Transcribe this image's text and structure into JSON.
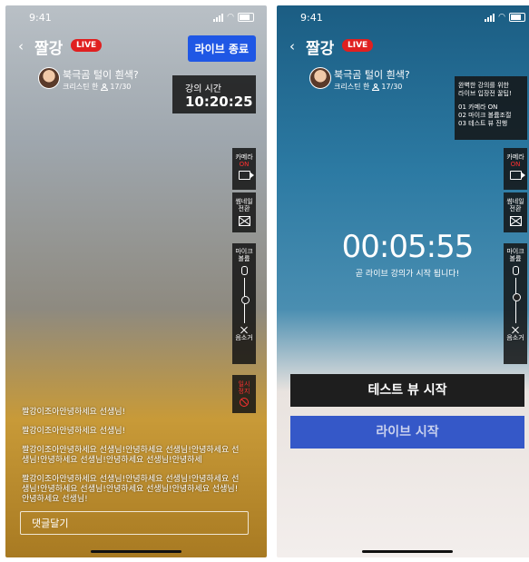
{
  "status_time": "9:41",
  "brand": "짤강",
  "live_badge": "LIVE",
  "lecture": {
    "title": "북극곰 털이 흰색?",
    "instructor": "크리스틴 한",
    "viewers": "17/30"
  },
  "screen1": {
    "end_button": "라이브 종료",
    "timer_label": "강의 시간",
    "timer_value": "10:20:25",
    "camera": {
      "label": "카메라",
      "state": "ON"
    },
    "thumbnail": {
      "line1": "썸네일",
      "line2": "전환"
    },
    "mic": {
      "line1": "마이크",
      "line2": "볼륨",
      "bottom": "음소거",
      "level": 0.55
    },
    "pause": {
      "line1": "일시",
      "line2": "정지"
    },
    "chat": [
      "짤강이조아안녕하세요 선생님!",
      "짤강이조아안녕하세요 선생님!",
      "짤강이조아안녕하세요 선생님!안녕하세요 선생님!안녕하세요 선생님!안녕하세요 선생님!안녕하세요 선생님!안녕하세",
      "짤강이조아안녕하세요 선생님!안녕하세요 선생님!안녕하세요 선생님!안녕하세요 선생님!안녕하세요 선생님!안녕하세요 선생님!안녕하세요 선생님!"
    ],
    "comment_placeholder": "댓글달기"
  },
  "screen2": {
    "info": {
      "title1": "완벽한 강의를 위한",
      "title2": "라이브 입장전 꿀팁!",
      "items": [
        "01 카메라 ON",
        "02 마이크 볼륨조절",
        "03 테스트 뷰 진행"
      ]
    },
    "camera": {
      "label": "카메라",
      "state": "ON"
    },
    "thumbnail": {
      "line1": "썸네일",
      "line2": "전환"
    },
    "mic": {
      "line1": "마이크",
      "line2": "볼륨",
      "bottom": "음소거",
      "level": 0.6
    },
    "countdown": "00:05:55",
    "notice": "곧 라이브 강의가 시작 됩니다!",
    "test_button": "테스트 뷰 시작",
    "live_button": "라이브 시작"
  }
}
